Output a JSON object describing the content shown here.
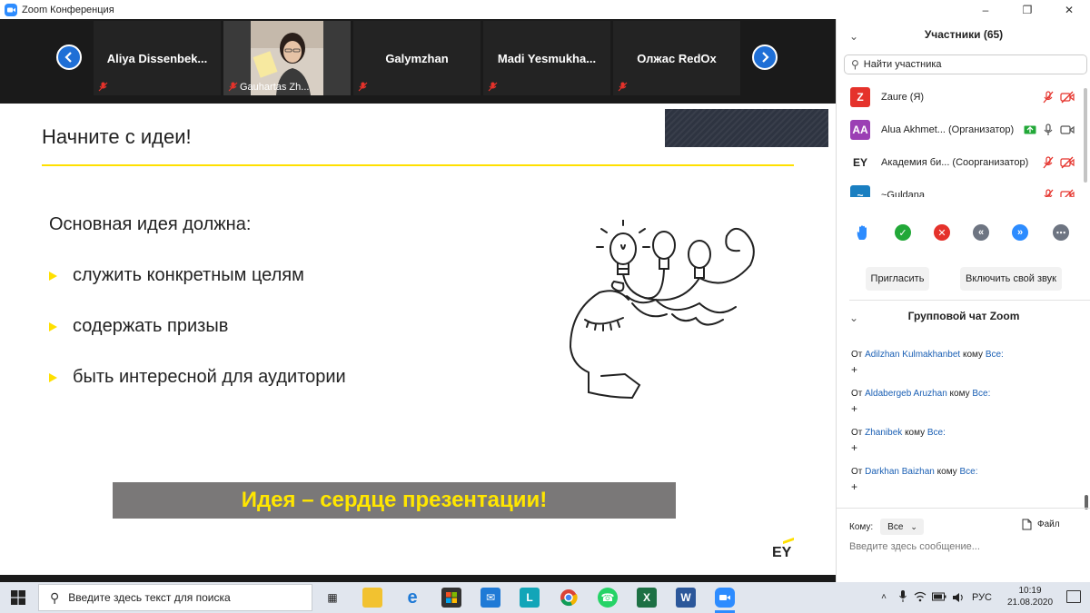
{
  "window": {
    "title": "Zoom Конференция"
  },
  "strip": {
    "tiles": [
      {
        "name": "Aliya  Dissenbek..."
      },
      {
        "name": "Gauhartas Zh..."
      },
      {
        "name": "Galymzhan"
      },
      {
        "name": "Madi  Yesmukha..."
      },
      {
        "name": "Олжас RedOx"
      }
    ]
  },
  "slide": {
    "title": "Начните с идеи!",
    "lead": "Основная идея должна:",
    "bullets": [
      "служить конкретным целям",
      "содержать призыв",
      "быть интересной для аудитории"
    ],
    "banner": "Идея – сердце презентации!",
    "logo": "EY"
  },
  "panel": {
    "participants_title": "Участники (65)",
    "search_placeholder": "Найти участника",
    "participants": [
      {
        "avatar": "Z",
        "color": "#e5322b",
        "name": "Zaure (Я)"
      },
      {
        "avatar": "AA",
        "color": "#9b3fb4",
        "name": "Alua Akhmet... (Организатор)"
      },
      {
        "avatar": "EY",
        "color": "#ffffff",
        "name": "Академия би...  (Соорганизатор)"
      },
      {
        "avatar": "~",
        "color": "#1a7fc1",
        "name": "~Guldana"
      }
    ],
    "invite_label": "Пригласить",
    "unmute_label": "Включить свой звук",
    "chat_title": "Групповой чат Zoom",
    "messages": [
      {
        "from_label": "От",
        "sender": "Adilzhan Kulmakhanbet",
        "to_label": "кому",
        "recipient": "Все:",
        "text": "+"
      },
      {
        "from_label": "От",
        "sender": "Aldabergeb Aruzhan",
        "to_label": "кому",
        "recipient": "Все:",
        "text": "+"
      },
      {
        "from_label": "От",
        "sender": "Zhanibek",
        "to_label": "кому",
        "recipient": "Все:",
        "text": "+"
      },
      {
        "from_label": "От",
        "sender": "Darkhan Baizhan",
        "to_label": "кому",
        "recipient": "Все:",
        "text": "+"
      }
    ],
    "to_label": "Кому:",
    "to_value": "Все",
    "file_label": "Файл",
    "message_placeholder": "Введите здесь сообщение..."
  },
  "taskbar": {
    "search_placeholder": "Введите здесь текст для поиска",
    "lang": "РУС",
    "time": "10:19",
    "date": "21.08.2020"
  },
  "colors": {
    "accent": "#2D8CFF",
    "slide_yellow": "#ffe000",
    "banner_gray": "#7a7878"
  }
}
